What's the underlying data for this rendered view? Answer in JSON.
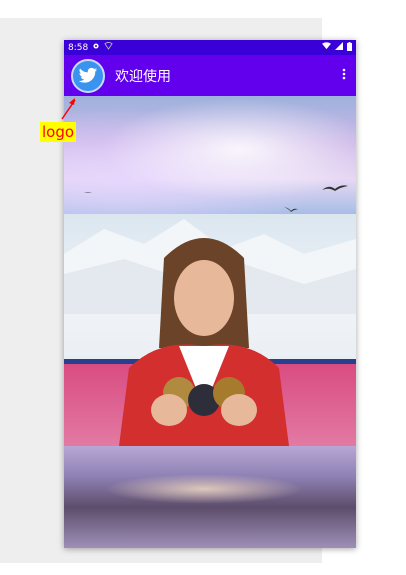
{
  "status_bar": {
    "time": "8:58",
    "left_icons": [
      "gear-icon",
      "signal-outline-icon"
    ],
    "right_icons": [
      "wifi-icon",
      "cell-signal-icon",
      "battery-icon"
    ]
  },
  "app_bar": {
    "logo_icon": "twitter-bird-icon",
    "title": "欢迎使用",
    "menu_icon": "overflow-menu-icon",
    "background_color": "#6200ee",
    "status_color": "#3a00d8"
  },
  "annotation": {
    "label": "logo",
    "label_color": "#ff0000",
    "label_background": "#ffff00"
  },
  "content": {
    "images": [
      "sky-with-birds-image",
      "athlete-with-medals-image",
      "water-reflection-image"
    ]
  }
}
